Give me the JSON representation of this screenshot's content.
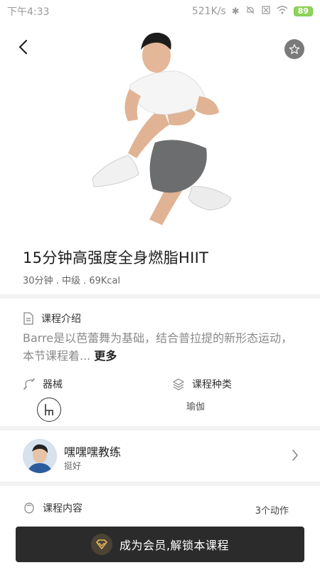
{
  "status_bar": {
    "time": "下午4:33",
    "net_speed": "521K/s",
    "battery": "89"
  },
  "course": {
    "title": "15分钟高强度全身燃脂HIIT",
    "meta": "30分钟 . 中级 . 69Kcal"
  },
  "intro": {
    "label": "课程介绍",
    "text": "Barre是以芭蕾舞为基础，结合普拉提的新形态运动，本节课程着...",
    "more": "更多"
  },
  "equipment": {
    "label": "器械"
  },
  "course_type": {
    "label": "课程种类",
    "value": "瑜伽"
  },
  "coach": {
    "name": "嘿嘿嘿教练",
    "subtitle": "挺好"
  },
  "content": {
    "label": "课程内容",
    "count": "3个动作"
  },
  "cta": {
    "label": "成为会员,解锁本课程"
  },
  "colors": {
    "cta_background": "#2b2b2b",
    "battery_green": "#8fd35a"
  },
  "icons": [
    "back-arrow-icon",
    "star-icon",
    "document-icon",
    "jump-rope-icon",
    "chair-icon",
    "layers-icon",
    "chevron-right-icon",
    "dumbbell-icon",
    "vip-diamond-icon"
  ]
}
